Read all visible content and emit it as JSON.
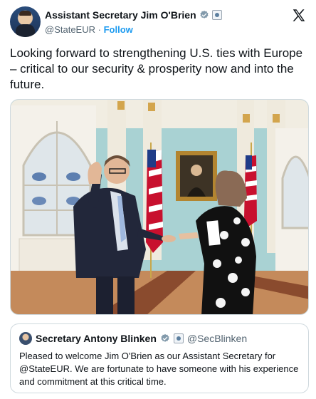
{
  "author": {
    "display_name": "Assistant Secretary Jim O'Brien",
    "handle": "@StateEUR",
    "separator": "·",
    "follow_label": "Follow"
  },
  "tweet": {
    "text": "Looking forward to strengthening U.S. ties with Europe – critical to our security & prosperity now and into the future."
  },
  "quoted": {
    "display_name": "Secretary Antony Blinken",
    "handle": "@SecBlinken",
    "text": "Pleased to welcome Jim O'Brien as our Assistant Secretary for @StateEUR. We are fortunate to have someone with his experience and commitment at this critical time."
  },
  "icons": {
    "verified": "verified-badge-icon",
    "government": "government-seal-icon",
    "platform": "x-logo-icon"
  },
  "colors": {
    "link": "#1d9bf0",
    "verified": "#829aab",
    "text": "#0f1419",
    "muted": "#536471",
    "border": "#cfd9de"
  }
}
